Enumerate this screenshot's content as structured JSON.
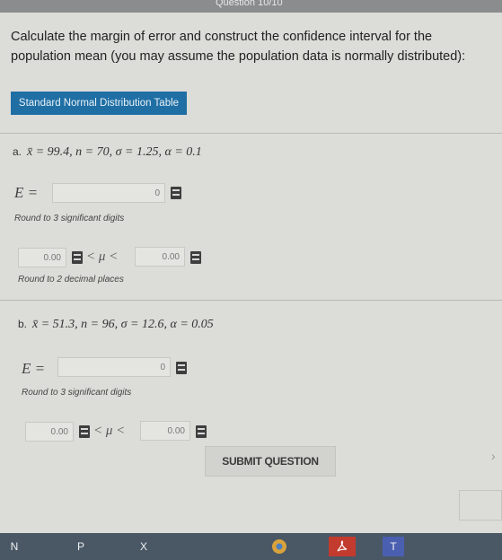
{
  "header": {
    "question_label": "Question 10/10"
  },
  "prompt": "Calculate the margin of error and construct the confidence interval for the population mean (you may assume the population data is normally distributed):",
  "table_button_label": "Standard Normal Distribution Table",
  "parts": [
    {
      "label": "a.",
      "given": "x̄ = 99.4, n = 70, σ = 1.25, α = 0.1",
      "e_label": "E =",
      "e_value": "0",
      "e_hint": "Round to 3 significant digits",
      "lower_value": "0.00",
      "inequality": "< μ <",
      "upper_value": "0.00",
      "interval_hint": "Round to 2 decimal places"
    },
    {
      "label": "b.",
      "given": "x̄ = 51.3, n = 96, σ = 12.6, α = 0.05",
      "e_label": "E =",
      "e_value": "0",
      "e_hint": "Round to 3 significant digits",
      "lower_value": "0.00",
      "inequality": "< μ <",
      "upper_value": "0.00"
    }
  ],
  "submit_label": "SUBMIT QUESTION",
  "taskbar": {
    "items": [
      {
        "icon": "onenote-icon",
        "label": "N",
        "color": "#7b3fa0"
      },
      {
        "icon": "powerpoint-icon",
        "label": "P",
        "color": "#c8472a"
      },
      {
        "icon": "excel-icon",
        "label": "X",
        "color": "#2a7d4a"
      },
      {
        "icon": "chrome-icon",
        "label": "",
        "color": "#d9a23a"
      },
      {
        "icon": "acrobat-icon",
        "label": "",
        "color": "#c23b2e"
      },
      {
        "icon": "teams-icon",
        "label": "T",
        "color": "#4b5fb0"
      }
    ]
  },
  "colors": {
    "accent": "#1f6fa5",
    "background": "#dcdcd8"
  }
}
